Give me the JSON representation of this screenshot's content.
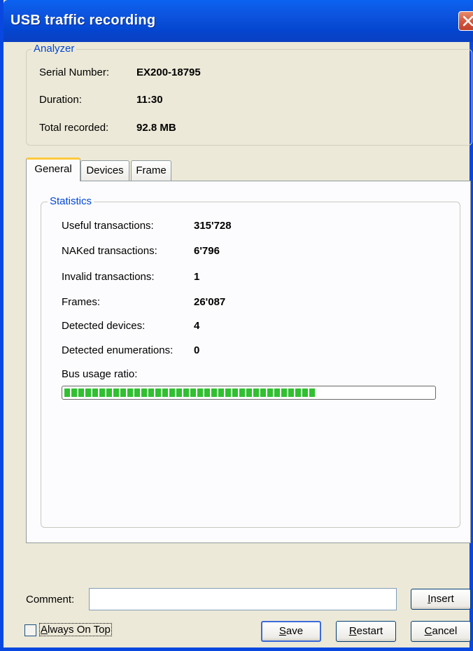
{
  "window": {
    "title": "USB traffic recording",
    "accent": "#0848e0"
  },
  "analyzer": {
    "legend": "Analyzer",
    "rows": [
      {
        "label": "Serial Number:",
        "value": "EX200-18795"
      },
      {
        "label": "Duration:",
        "value": "11:30"
      },
      {
        "label": "Total recorded:",
        "value": "92.8 MB"
      }
    ]
  },
  "tabs": [
    {
      "label": "General",
      "active": true
    },
    {
      "label": "Devices",
      "active": false
    },
    {
      "label": "Frame",
      "active": false
    }
  ],
  "statistics": {
    "legend": "Statistics",
    "rows": [
      {
        "label": "Useful transactions:",
        "value": "315'728"
      },
      {
        "label": "NAKed transactions:",
        "value": "6'796"
      },
      {
        "label": "Invalid transactions:",
        "value": "1"
      },
      {
        "label": "Frames:",
        "value": "26'087"
      },
      {
        "label": "Detected devices:",
        "value": "4"
      },
      {
        "label": "Detected enumerations:",
        "value": "0"
      }
    ],
    "bus_usage_label": "Bus usage ratio:",
    "bus_usage_fraction": 0.68,
    "bus_usage_color": "#30c030"
  },
  "footer": {
    "comment_label": "Comment:",
    "comment_value": "",
    "insert_first": "I",
    "insert_rest": "nsert",
    "always_on_top_first": "A",
    "always_on_top_rest": "lways On Top",
    "always_on_top_checked": false,
    "save_first": "S",
    "save_rest": "ave",
    "restart_first": "R",
    "restart_rest": "estart",
    "cancel_first": "C",
    "cancel_rest": "ancel"
  }
}
